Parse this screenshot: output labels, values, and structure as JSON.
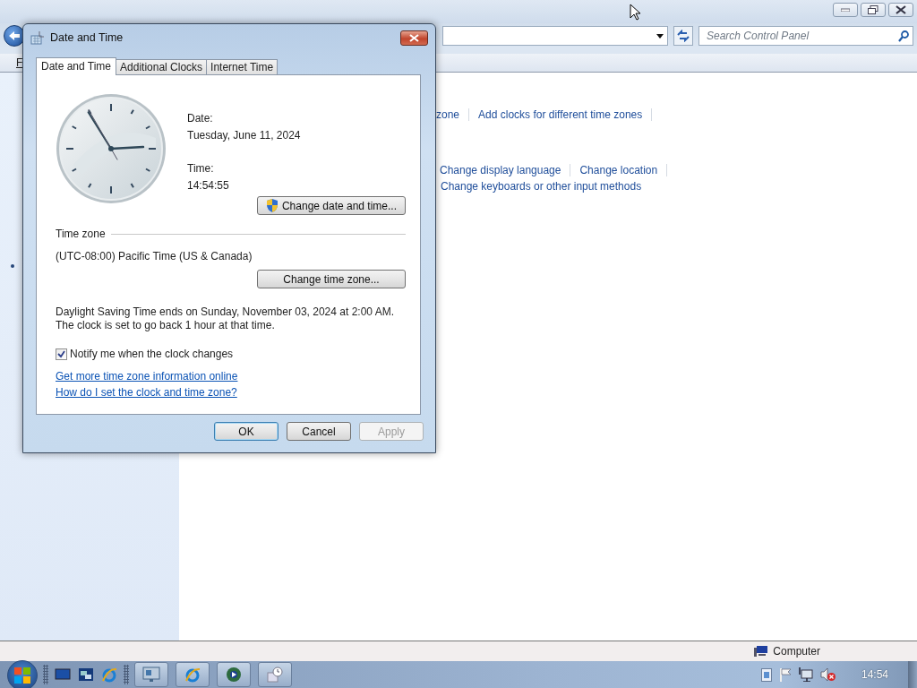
{
  "control_panel": {
    "search": {
      "placeholder": "Search Control Panel"
    },
    "menu": [
      "F"
    ],
    "link_rows": [
      [
        "zone",
        "Add clocks for different time zones"
      ],
      [
        "Change display language",
        "Change location"
      ],
      [
        "Change keyboards or other input methods"
      ]
    ],
    "status_bar": {
      "location": "Computer"
    }
  },
  "dialog": {
    "title": "Date and Time",
    "tabs": [
      {
        "label": "Date and Time",
        "selected": true
      },
      {
        "label": "Additional Clocks",
        "selected": false
      },
      {
        "label": "Internet Time",
        "selected": false
      }
    ],
    "date_label": "Date:",
    "date": "Tuesday, June 11, 2024",
    "time_label": "Time:",
    "time": "14:54:55",
    "change_datetime_button": "Change date and time...",
    "timezone_heading": "Time zone",
    "timezone": "(UTC-08:00) Pacific Time (US & Canada)",
    "change_timezone_button": "Change time zone...",
    "dst_note": "Daylight Saving Time ends on Sunday, November 03, 2024 at 2:00 AM. The clock is set to go back 1 hour at that time.",
    "notify": {
      "label": "Notify me when the clock changes",
      "checked": true
    },
    "links": [
      "Get more time zone information online",
      "How do I set the clock and time zone?"
    ],
    "buttons": [
      {
        "label": "OK",
        "default": true,
        "disabled": false
      },
      {
        "label": "Cancel",
        "default": false,
        "disabled": false
      },
      {
        "label": "Apply",
        "default": false,
        "disabled": true
      }
    ]
  },
  "taskbar": {
    "clock": "14:54"
  }
}
